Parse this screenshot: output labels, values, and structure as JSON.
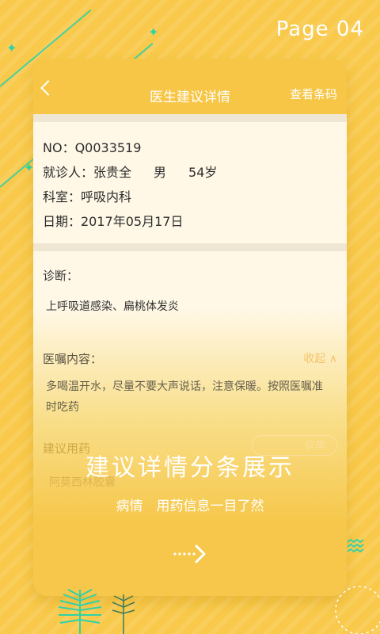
{
  "page": {
    "indicator": "Page 04"
  },
  "header": {
    "title": "医生建议详情",
    "action": "查看条码"
  },
  "patient": {
    "no": "NO：Q0033519",
    "visitor_label": "就诊人：",
    "name": "张贵全",
    "gender": "男",
    "age": "54岁",
    "department": "科室：呼吸内科",
    "date": "日期：2017年05月17日"
  },
  "diagnosis": {
    "label": "诊断：",
    "text": "上呼吸道感染、扁桃体发炎"
  },
  "advice": {
    "label": "医嘱内容：",
    "collapse": "收起 ∧",
    "text_line1": "多喝温开水，尽量不要大声说话，注意保暖。按照医嘱准",
    "text_line2": "时吃药"
  },
  "medication": {
    "label": "建议用药",
    "partial_button": "议单",
    "partial_row": "阿莫西林胶囊"
  },
  "overlay": {
    "title": "建议详情分条展示",
    "subtitle": "病情　用药信息一目了然"
  },
  "colors": {
    "accent": "#2fd2a8",
    "background": "#f8c94a",
    "card": "#fff8e7"
  }
}
